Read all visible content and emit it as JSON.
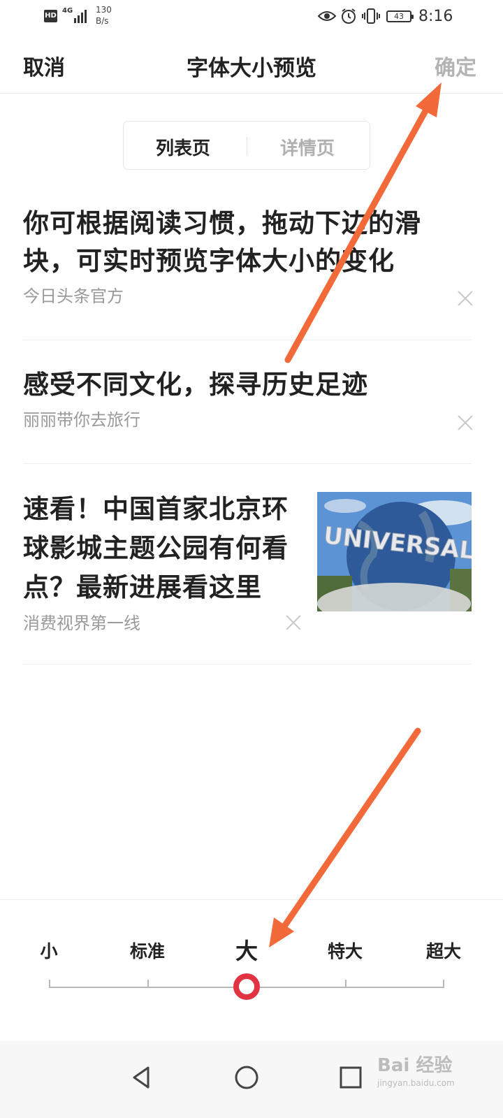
{
  "status_bar": {
    "hd": "HD",
    "network": "4G",
    "speed_value": "130",
    "speed_unit": "B/s",
    "battery": "43",
    "time": "8:16",
    "icons": [
      "eye-icon",
      "alarm-icon",
      "vibrate-icon"
    ]
  },
  "header": {
    "cancel_label": "取消",
    "title": "字体大小预览",
    "confirm_label": "确定"
  },
  "tabs": {
    "list_label": "列表页",
    "detail_label": "详情页",
    "selected": "列表页"
  },
  "feed": [
    {
      "title": "你可根据阅读习惯，拖动下边的滑块，可实时预览字体大小的变化",
      "source": "今日头条官方"
    },
    {
      "title": "感受不同文化，探寻历史足迹",
      "source": "丽丽带你去旅行"
    },
    {
      "title": "速看！中国首家北京环球影城主题公园有何看点？最新进展看这里",
      "source": "消费视界第一线",
      "thumbnail_text": "UNIVERSAL"
    }
  ],
  "font_size": {
    "options": [
      "小",
      "标准",
      "大",
      "特大",
      "超大"
    ],
    "selected_index": 2,
    "accent_color": "#e23342"
  },
  "nav_bar": {
    "icons": [
      "back-icon",
      "home-icon",
      "recents-icon"
    ],
    "watermark_main": "Bai 经验",
    "watermark_sub": "jingyan.baidu.com"
  },
  "annotation": {
    "arrow_color": "#f26a3a"
  }
}
